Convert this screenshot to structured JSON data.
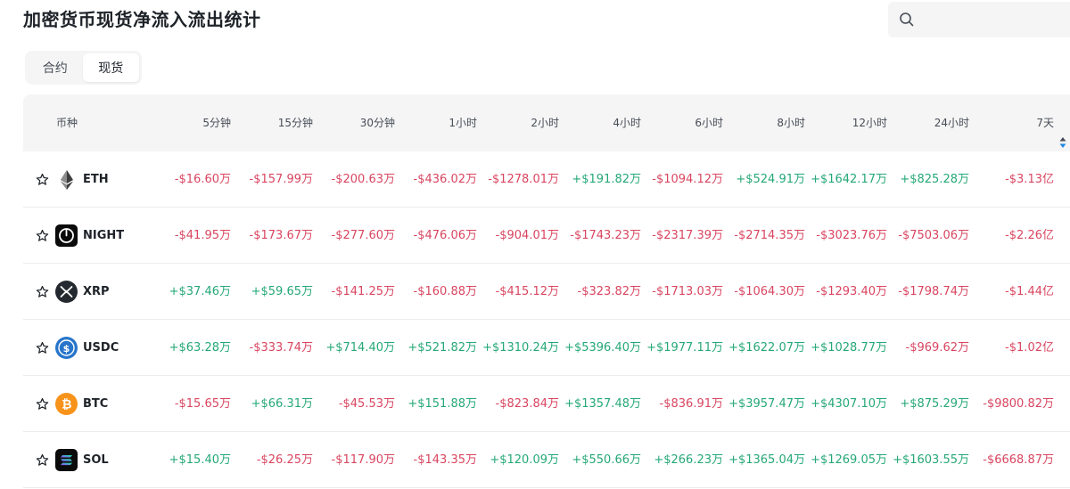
{
  "header": {
    "title": "加密货币现货净流入流出统计"
  },
  "search": {
    "value": ""
  },
  "tabs": [
    {
      "label": "合约",
      "active": false
    },
    {
      "label": "现货",
      "active": true
    }
  ],
  "colors": {
    "positive": "#25a878",
    "negative": "#d94560"
  },
  "table": {
    "columns": [
      "币种",
      "5分钟",
      "15分钟",
      "30分钟",
      "1小时",
      "2小时",
      "4小时",
      "6小时",
      "8小时",
      "12小时",
      "24小时",
      "7天"
    ],
    "sorted_column": "7天",
    "rows": [
      {
        "symbol": "ETH",
        "icon": "eth-icon",
        "values": [
          "-$16.60万",
          "-$157.99万",
          "-$200.63万",
          "-$436.02万",
          "-$1278.01万",
          "+$191.82万",
          "-$1094.12万",
          "+$524.91万",
          "+$1642.17万",
          "+$825.28万",
          "-$3.13亿"
        ]
      },
      {
        "symbol": "NIGHT",
        "icon": "night-icon",
        "values": [
          "-$41.95万",
          "-$173.67万",
          "-$277.60万",
          "-$476.06万",
          "-$904.01万",
          "-$1743.23万",
          "-$2317.39万",
          "-$2714.35万",
          "-$3023.76万",
          "-$7503.06万",
          "-$2.26亿"
        ]
      },
      {
        "symbol": "XRP",
        "icon": "xrp-icon",
        "values": [
          "+$37.46万",
          "+$59.65万",
          "-$141.25万",
          "-$160.88万",
          "-$415.12万",
          "-$323.82万",
          "-$1713.03万",
          "-$1064.30万",
          "-$1293.40万",
          "-$1798.74万",
          "-$1.44亿"
        ]
      },
      {
        "symbol": "USDC",
        "icon": "usdc-icon",
        "values": [
          "+$63.28万",
          "-$333.74万",
          "+$714.40万",
          "+$521.82万",
          "+$1310.24万",
          "+$5396.40万",
          "+$1977.11万",
          "+$1622.07万",
          "+$1028.77万",
          "-$969.62万",
          "-$1.02亿"
        ]
      },
      {
        "symbol": "BTC",
        "icon": "btc-icon",
        "values": [
          "-$15.65万",
          "+$66.31万",
          "-$45.53万",
          "+$151.88万",
          "-$823.84万",
          "+$1357.48万",
          "-$836.91万",
          "+$3957.47万",
          "+$4307.10万",
          "+$875.29万",
          "-$9800.82万"
        ]
      },
      {
        "symbol": "SOL",
        "icon": "sol-icon",
        "values": [
          "+$15.40万",
          "-$26.25万",
          "-$117.90万",
          "-$143.35万",
          "+$120.09万",
          "+$550.66万",
          "+$266.23万",
          "+$1365.04万",
          "+$1269.05万",
          "+$1603.55万",
          "-$6668.87万"
        ]
      }
    ]
  }
}
